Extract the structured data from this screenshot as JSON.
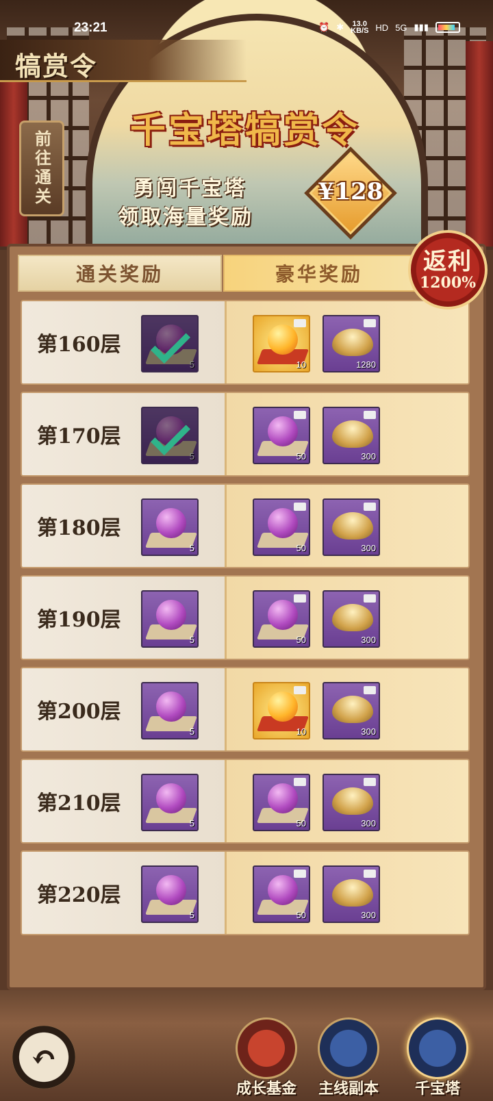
{
  "status_bar": {
    "time": "23:21",
    "net_speed": "13.0",
    "net_unit": "KB/S",
    "hd": "HD",
    "network": "5G"
  },
  "header": {
    "banner_title": "犒赏令",
    "go_clear": "前往通关",
    "title": "千宝塔犒赏令",
    "subtitle_1": "勇闯千宝塔",
    "subtitle_2": "领取海量奖励",
    "price": "¥128"
  },
  "tabs": {
    "basic": "通关奖励",
    "deluxe": "豪华奖励"
  },
  "rebate": {
    "line1": "返利",
    "line2": "1200%"
  },
  "rows": [
    {
      "floor": "第160层",
      "free": {
        "qty": "5",
        "claimed": true
      },
      "deluxe": [
        {
          "kind": "gold-orb",
          "qty": "10"
        },
        {
          "kind": "ingot",
          "qty": "1280"
        }
      ]
    },
    {
      "floor": "第170层",
      "free": {
        "qty": "5",
        "claimed": true
      },
      "deluxe": [
        {
          "kind": "orb",
          "qty": "50"
        },
        {
          "kind": "ingot",
          "qty": "300"
        }
      ]
    },
    {
      "floor": "第180层",
      "free": {
        "qty": "5",
        "claimed": false
      },
      "deluxe": [
        {
          "kind": "orb",
          "qty": "50"
        },
        {
          "kind": "ingot",
          "qty": "300"
        }
      ]
    },
    {
      "floor": "第190层",
      "free": {
        "qty": "5",
        "claimed": false
      },
      "deluxe": [
        {
          "kind": "orb",
          "qty": "50"
        },
        {
          "kind": "ingot",
          "qty": "300"
        }
      ]
    },
    {
      "floor": "第200层",
      "free": {
        "qty": "5",
        "claimed": false
      },
      "deluxe": [
        {
          "kind": "gold-orb",
          "qty": "10"
        },
        {
          "kind": "ingot",
          "qty": "300"
        }
      ]
    },
    {
      "floor": "第210层",
      "free": {
        "qty": "5",
        "claimed": false
      },
      "deluxe": [
        {
          "kind": "orb",
          "qty": "50"
        },
        {
          "kind": "ingot",
          "qty": "300"
        }
      ]
    },
    {
      "floor": "第220层",
      "free": {
        "qty": "5",
        "claimed": false
      },
      "deluxe": [
        {
          "kind": "orb",
          "qty": "50"
        },
        {
          "kind": "ingot",
          "qty": "300"
        }
      ]
    }
  ],
  "bottom_nav": {
    "back_icon": "back-arrow-icon",
    "growth_fund": "成长基金",
    "main_dungeon": "主线副本",
    "tower": "千宝塔"
  }
}
